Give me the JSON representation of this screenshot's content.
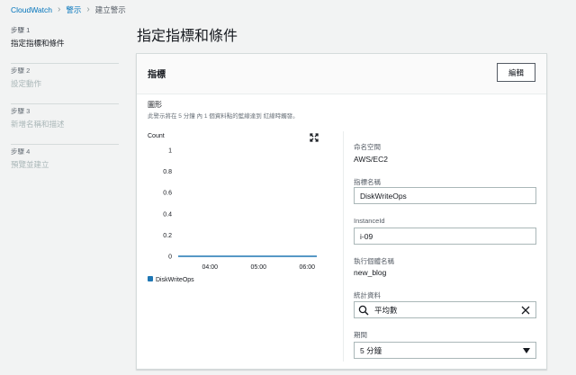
{
  "breadcrumb": {
    "root": "CloudWatch",
    "alarms": "警示",
    "current": "建立警示"
  },
  "steps": [
    {
      "num": "步驟 1",
      "name": "指定指標和條件",
      "active": true
    },
    {
      "num": "步驟 2",
      "name": "設定動作",
      "active": false
    },
    {
      "num": "步驟 3",
      "name": "新增名稱和描述",
      "active": false
    },
    {
      "num": "步驟 4",
      "name": "預覽並建立",
      "active": false
    }
  ],
  "page": {
    "title": "指定指標和條件"
  },
  "card": {
    "title": "指標",
    "edit_label": "編輯",
    "graph_label": "圖形",
    "graph_desc": "此警示將在 5 分鐘 內 1 個資料點的藍線達到 紅線時觸發。"
  },
  "chart_data": {
    "type": "line",
    "ylabel": "Count",
    "yticks": [
      "1",
      "0.8",
      "0.6",
      "0.4",
      "0.2",
      "0"
    ],
    "ylim": [
      0,
      1
    ],
    "xticks": [
      "04:00",
      "05:00",
      "06:00"
    ],
    "series": [
      {
        "name": "DiskWriteOps",
        "color": "#1f77b4",
        "values": [
          0,
          0,
          0,
          0,
          0,
          0,
          0,
          0
        ]
      }
    ],
    "grid": false,
    "legend": "bottom-left"
  },
  "fields": {
    "namespace_label": "命名空間",
    "namespace_value": "AWS/EC2",
    "metric_label": "指標名稱",
    "metric_value": "DiskWriteOps",
    "instance_label": "InstanceId",
    "instance_value": "i-09",
    "instance_name_label": "執行個體名稱",
    "instance_name_value": "new_blog",
    "statistic_label": "統計資料",
    "statistic_value": "平均數",
    "period_label": "期間",
    "period_value": "5 分鐘"
  },
  "icons": {
    "breadcrumb_sep": "chevron-right-icon",
    "expand": "expand-icon",
    "search": "search-icon",
    "clear": "clear-icon",
    "caret": "caret-down-icon"
  },
  "colors": {
    "link": "#0073bb",
    "series": "#1f77b4"
  }
}
